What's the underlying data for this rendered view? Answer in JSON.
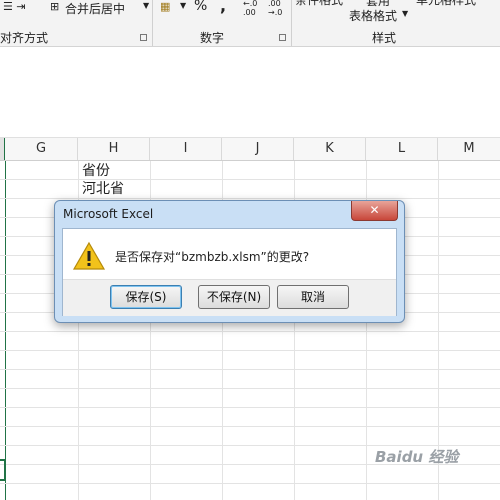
{
  "ribbon": {
    "merge_center_label": "合并后居中",
    "alignment_group": "对齐方式",
    "percent_symbol": "%",
    "comma_symbol": ",",
    "number_group": "数字",
    "conditional_format": "条件格式",
    "apply_label": "套用",
    "table_format_label": "表格格式",
    "cell_styles_label": "单元格样式",
    "styles_group": "样式"
  },
  "sheet": {
    "columns": [
      "G",
      "H",
      "I",
      "J",
      "K",
      "L",
      "M"
    ],
    "cells": {
      "h1": "省份",
      "h2": "河北省"
    }
  },
  "dialog": {
    "title": "Microsoft Excel",
    "close_symbol": "✕",
    "message": "是否保存对“bzmbzb.xlsm”的更改?",
    "buttons": {
      "save": "保存(S)",
      "dont_save": "不保存(N)",
      "cancel": "取消"
    }
  },
  "watermark": "Baidu 经验",
  "colors": {
    "dialog_frame": "#c9dff5",
    "close_red": "#c8473a",
    "warning_yellow": "#f2c21b"
  }
}
